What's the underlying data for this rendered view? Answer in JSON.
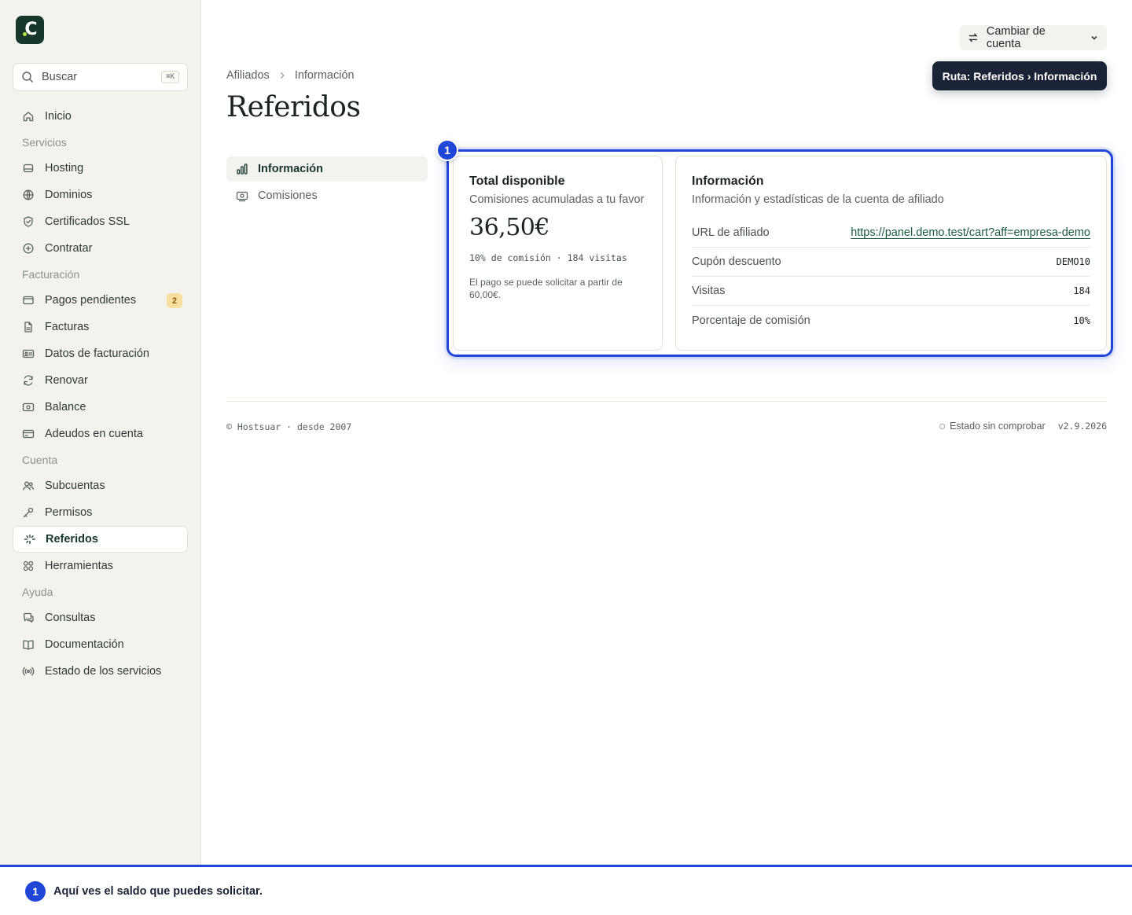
{
  "sidebar": {
    "search": {
      "label": "Buscar",
      "shortcut": "⌘K"
    },
    "items": [
      {
        "type": "item",
        "label": "Inicio",
        "icon": "home-icon"
      },
      {
        "type": "section",
        "label": "Servicios"
      },
      {
        "type": "item",
        "label": "Hosting",
        "icon": "server-icon"
      },
      {
        "type": "item",
        "label": "Dominios",
        "icon": "globe-icon"
      },
      {
        "type": "item",
        "label": "Certificados SSL",
        "icon": "shield-icon"
      },
      {
        "type": "item",
        "label": "Contratar",
        "icon": "plus-circle-icon"
      },
      {
        "type": "section",
        "label": "Facturación"
      },
      {
        "type": "item",
        "label": "Pagos pendientes",
        "icon": "mail-icon",
        "badge": "2"
      },
      {
        "type": "item",
        "label": "Facturas",
        "icon": "document-icon"
      },
      {
        "type": "item",
        "label": "Datos de facturación",
        "icon": "id-card-icon"
      },
      {
        "type": "item",
        "label": "Renovar",
        "icon": "refresh-icon"
      },
      {
        "type": "item",
        "label": "Balance",
        "icon": "banknote-icon"
      },
      {
        "type": "item",
        "label": "Adeudos en cuenta",
        "icon": "credit-card-icon"
      },
      {
        "type": "section",
        "label": "Cuenta"
      },
      {
        "type": "item",
        "label": "Subcuentas",
        "icon": "users-icon"
      },
      {
        "type": "item",
        "label": "Permisos",
        "icon": "key-icon"
      },
      {
        "type": "item",
        "label": "Referidos",
        "icon": "sparkles-icon",
        "active": true
      },
      {
        "type": "item",
        "label": "Herramientas",
        "icon": "grid-icon"
      },
      {
        "type": "section",
        "label": "Ayuda"
      },
      {
        "type": "item",
        "label": "Consultas",
        "icon": "chat-icon"
      },
      {
        "type": "item",
        "label": "Documentación",
        "icon": "book-icon"
      },
      {
        "type": "item",
        "label": "Estado de los servicios",
        "icon": "broadcast-icon"
      }
    ]
  },
  "header": {
    "switch_label": "Cambiar de cuenta",
    "tooltip": "Ruta: Referidos › Información",
    "breadcrumb": [
      "Afiliados",
      "Información"
    ],
    "title": "Referidos"
  },
  "subnav": [
    {
      "label": "Información",
      "icon": "bar-chart-icon",
      "active": true
    },
    {
      "label": "Comisiones",
      "icon": "banknote-icon",
      "active": false
    }
  ],
  "summary_card": {
    "title": "Total disponible",
    "subtitle": "Comisiones acumuladas a tu favor",
    "amount": "36,50€",
    "stats": "10% de comisión · 184 visitas",
    "note": "El pago se puede solicitar a partir de 60,00€."
  },
  "info_card": {
    "title": "Información",
    "subtitle": "Información y estadísticas de la cuenta de afiliado",
    "rows": [
      {
        "key": "URL de afiliado",
        "value": "https://panel.demo.test/cart?aff=empresa-demo",
        "link": true
      },
      {
        "key": "Cupón descuento",
        "value": "DEMO10"
      },
      {
        "key": "Visitas",
        "value": "184"
      },
      {
        "key": "Porcentaje de comisión",
        "value": "10%"
      }
    ]
  },
  "footer": {
    "copyright": "© Hostsuar · desde 2007",
    "status": "Estado sin comprobar",
    "version": "v2.9.2026"
  },
  "tour": {
    "step": "1",
    "text": "Aquí ves el saldo que puedes solicitar."
  },
  "colors": {
    "accent": "#1f46d6",
    "brand": "#16372b",
    "sidebar_bg": "#f4f2ec",
    "badge_bg": "#f6dfa0"
  }
}
